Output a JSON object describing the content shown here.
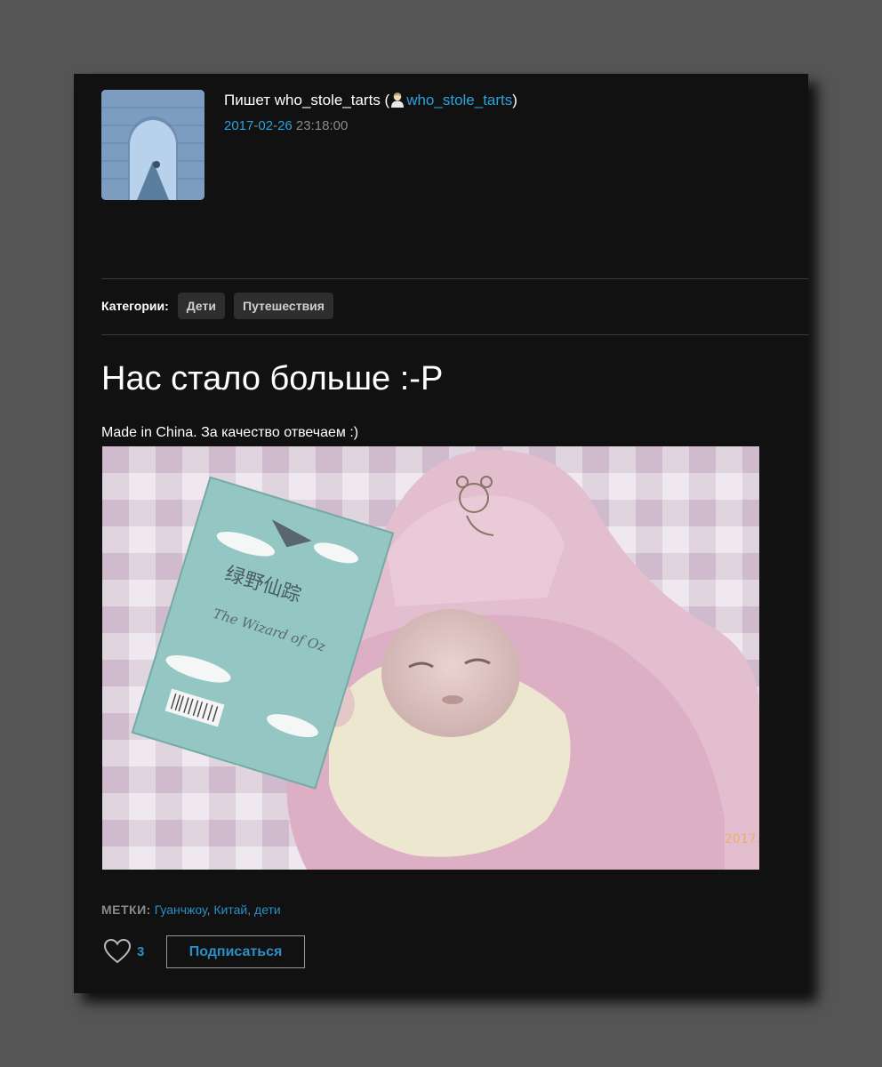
{
  "post": {
    "byline_prefix": "Пишет who_stole_tarts (",
    "author_link": "who_stole_tarts",
    "byline_suffix": ")",
    "date_year": "2017",
    "date_month": "02",
    "date_day": "26",
    "date_time": "23:18:00"
  },
  "categories": {
    "label": "Категории:",
    "items": [
      "Дети",
      "Путешествия"
    ]
  },
  "title": "Нас стало больше :-P",
  "intro": "Made in China. За качество отвечаем :)",
  "photo": {
    "stamp": "2017.",
    "book_title": "绿野仙踪",
    "book_subtitle": "The Wizard of Oz"
  },
  "tags": {
    "label": "МЕТКИ:",
    "items": [
      "Гуанчжоу",
      "Китай",
      "дети"
    ],
    "separator": ", "
  },
  "likes": {
    "count": "3"
  },
  "actions": {
    "subscribe_label": "Подписаться"
  },
  "colors": {
    "link": "#2aa3dc",
    "background": "#111112",
    "page": "#555555"
  }
}
